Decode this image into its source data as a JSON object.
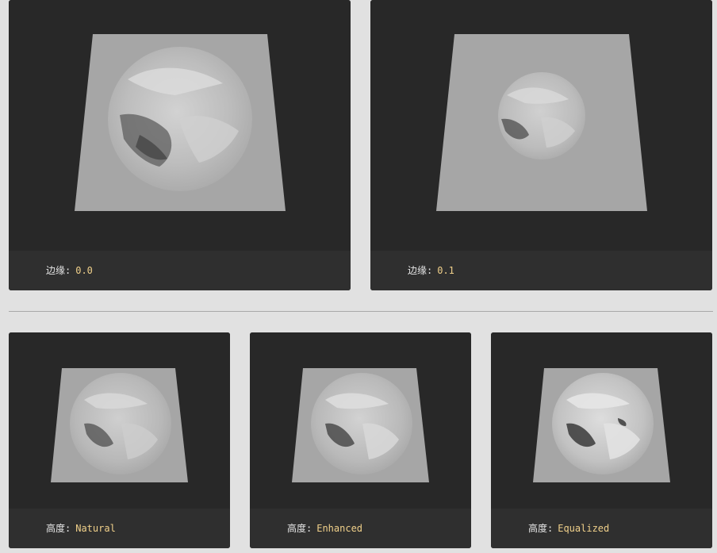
{
  "edge_panels": [
    {
      "label": "边缘:",
      "value": "0.0",
      "disc": "large"
    },
    {
      "label": "边缘:",
      "value": "0.1",
      "disc": "small"
    }
  ],
  "height_panels": [
    {
      "label": "高度:",
      "value": "Natural"
    },
    {
      "label": "高度:",
      "value": "Enhanced"
    },
    {
      "label": "高度:",
      "value": "Equalized"
    }
  ],
  "colors": {
    "background": "#e1e1e1",
    "panel": "#282828",
    "caption_bar": "#2f2f2f",
    "caption_value": "#f0d08a",
    "plane": "#a6a6a6"
  }
}
